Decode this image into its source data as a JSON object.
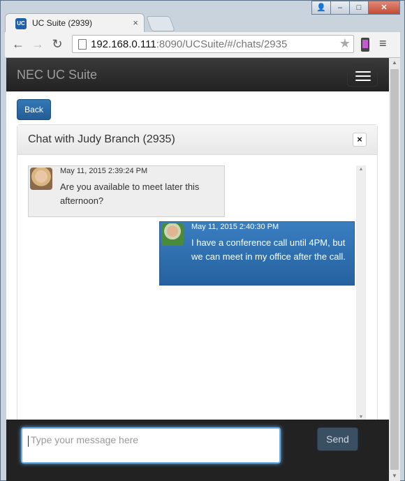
{
  "browser": {
    "tab_title": "UC Suite (2939)",
    "favicon_label": "UC",
    "url_host": "192.168.0.111",
    "url_rest": ":8090/UCSuite/#/chats/2935"
  },
  "app": {
    "brand": "NEC UC Suite",
    "back_label": "Back"
  },
  "chat": {
    "title": "Chat with Judy Branch (2935)",
    "close_label": "×",
    "messages": [
      {
        "direction": "in",
        "timestamp": "May 11, 2015 2:39:24 PM",
        "text": "Are you available to meet later this afternoon?"
      },
      {
        "direction": "out",
        "timestamp": "May 11, 2015 2:40:30 PM",
        "text": "I have a conference call until 4PM, but we can meet in my office after the call."
      }
    ]
  },
  "composer": {
    "placeholder": "Type your message here",
    "send_label": "Send"
  },
  "colors": {
    "navbar": "#222222",
    "outgoing_bubble": "#2f71b1",
    "incoming_bubble": "#eeeeee",
    "focus": "#66afe9"
  }
}
